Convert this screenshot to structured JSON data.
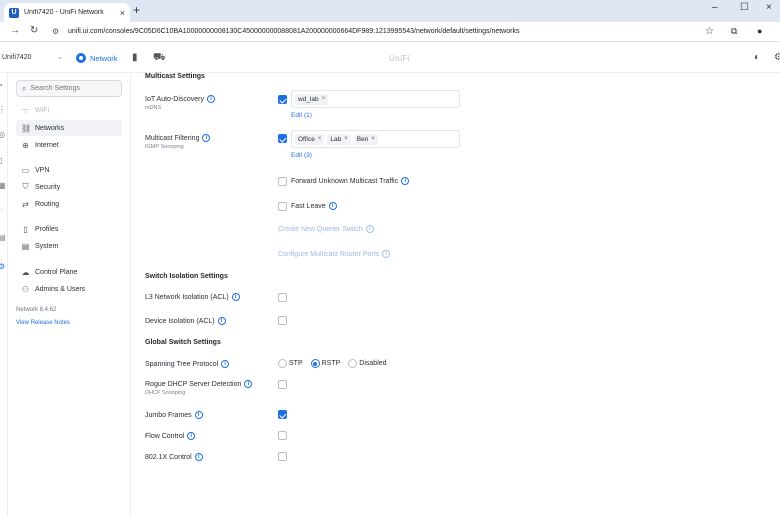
{
  "browser": {
    "tab_title": "Unifi7420 - UniFi Network",
    "favicon_letter": "U",
    "url": "unifi.ui.com/consoles/9C05D6C10BA10000000008130C450000000088081A200000000664DF989:1213995543/network/default/settings/networks"
  },
  "header": {
    "site_name": "Unifi7420",
    "app_name": "Network",
    "brand": "UniFi"
  },
  "sidebar": {
    "search_placeholder": "Search Settings",
    "items": [
      {
        "label": "WiFi",
        "icon": "wifi-icon"
      },
      {
        "label": "Networks",
        "icon": "networks-icon"
      },
      {
        "label": "Internet",
        "icon": "globe-icon"
      },
      {
        "label": "VPN",
        "icon": "vpn-icon"
      },
      {
        "label": "Security",
        "icon": "shield-icon"
      },
      {
        "label": "Routing",
        "icon": "routing-icon"
      },
      {
        "label": "Profiles",
        "icon": "profiles-icon"
      },
      {
        "label": "System",
        "icon": "system-icon"
      },
      {
        "label": "Control Plane",
        "icon": "control-plane-icon"
      },
      {
        "label": "Admins & Users",
        "icon": "user-icon"
      }
    ],
    "version": "Network 8.4.62",
    "release_notes": "View Release Notes"
  },
  "multicast": {
    "title": "Multicast Settings",
    "iot_label": "IoT Auto-Discovery",
    "iot_sub": "mDNS",
    "iot_chips": [
      "wd_lab"
    ],
    "iot_edit": "Edit (1)",
    "filtering_label": "Multicast Filtering",
    "filtering_sub": "IGMP Snooping",
    "filtering_chips": [
      "Office",
      "Lab",
      "Ben"
    ],
    "filtering_edit": "Edit (3)",
    "forward_unknown": "Forward Unknown Multicast Traffic",
    "fast_leave": "Fast Leave",
    "querier_switch": "Create New Querier Switch",
    "router_ports": "Configure Multicast Router Ports"
  },
  "isolation": {
    "title": "Switch Isolation Settings",
    "l3": "L3 Network Isolation (ACL)",
    "device": "Device Isolation (ACL)"
  },
  "global_switch": {
    "title": "Global Switch Settings",
    "stp_label": "Spanning Tree Protocol",
    "stp_options": [
      "STP",
      "RSTP",
      "Disabled"
    ],
    "stp_selected": "RSTP",
    "rogue_dhcp": "Rogue DHCP Server Detection",
    "rogue_dhcp_sub": "DHCP Snooping",
    "jumbo": "Jumbo Frames",
    "flow": "Flow Control",
    "dot1x": "802.1X Control"
  },
  "colors": {
    "accent": "#1f6fe5",
    "tabbar": "#dfe7f4"
  }
}
